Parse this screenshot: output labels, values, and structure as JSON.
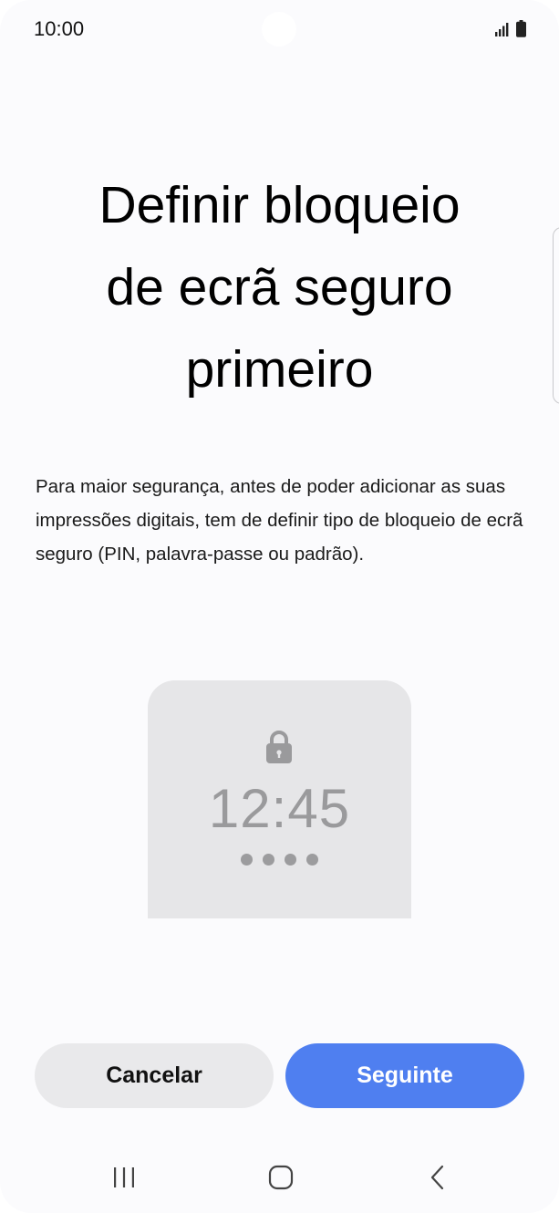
{
  "status_bar": {
    "time": "10:00",
    "icons": [
      "signal-icon",
      "battery-icon"
    ]
  },
  "title": {
    "line1": "Definir bloqueio",
    "line2": "de ecrã seguro",
    "line3": "primeiro"
  },
  "description": "Para maior segurança, antes de poder adicionar as suas impressões digitais, tem de definir tipo de bloqueio de ecrã seguro (PIN, palavra-passe ou padrão).",
  "illustration": {
    "time": "12:45",
    "icon": "lock-icon",
    "pin_dot_count": 4
  },
  "buttons": {
    "cancel_label": "Cancelar",
    "next_label": "Seguinte"
  },
  "navigation": {
    "icons": [
      "recents-icon",
      "home-icon",
      "back-icon"
    ]
  },
  "colors": {
    "accent": "#4f7ff0",
    "secondary_button": "#e9e9eb",
    "illustration_bg": "#e6e6e8",
    "illustration_fg": "#9a9a9c"
  }
}
